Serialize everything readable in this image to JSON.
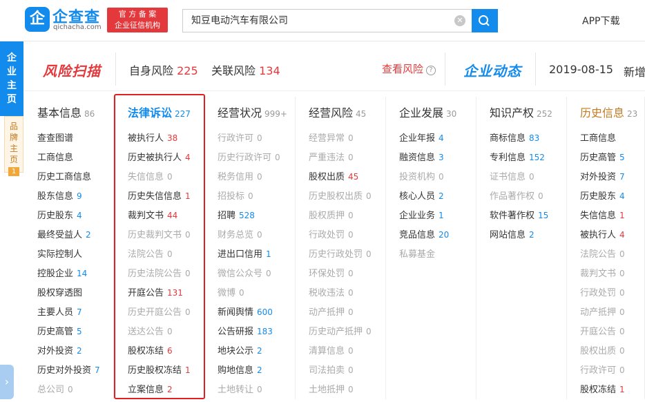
{
  "header": {
    "logo_char": "企",
    "logo_name": "企查查",
    "logo_url": "qichacha.com",
    "cert_line1": "官 方 备 案",
    "cert_line2": "企业征信机构",
    "search_value": "知豆电动汽车有限公司",
    "clear_icon": "clear-icon",
    "search_icon": "search-icon",
    "app_download": "APP下载"
  },
  "side": {
    "company_home": [
      "企",
      "业",
      "主",
      "页"
    ],
    "brand_home": [
      "品",
      "牌",
      "主",
      "页"
    ],
    "brand_count": "1",
    "expand_icon": "chevron-right-icon"
  },
  "risk": {
    "logo": "风险扫描",
    "self_label": "自身风险",
    "self_count": "225",
    "related_label": "关联风险",
    "related_count": "134",
    "check_label": "查看风险",
    "dynamic_logo": "企业动态",
    "dynamic_date": "2019-08-15",
    "dynamic_new": "新增"
  },
  "columns": [
    {
      "title": "基本信息",
      "count": "86",
      "items": [
        {
          "label": "查查图谱",
          "count": ""
        },
        {
          "label": "工商信息",
          "count": ""
        },
        {
          "label": "历史工商信息",
          "count": ""
        },
        {
          "label": "股东信息",
          "count": "9"
        },
        {
          "label": "历史股东",
          "count": "4"
        },
        {
          "label": "最终受益人",
          "count": "2"
        },
        {
          "label": "实际控制人",
          "count": ""
        },
        {
          "label": "控股企业",
          "count": "14"
        },
        {
          "label": "股权穿透图",
          "count": ""
        },
        {
          "label": "主要人员",
          "count": "7"
        },
        {
          "label": "历史高管",
          "count": "5"
        },
        {
          "label": "对外投资",
          "count": "2"
        },
        {
          "label": "历史对外投资",
          "count": "7"
        },
        {
          "label": "总公司",
          "count": "0"
        }
      ]
    },
    {
      "title": "法律诉讼",
      "count": "227",
      "items": [
        {
          "label": "被执行人",
          "count": "38"
        },
        {
          "label": "历史被执行人",
          "count": "4"
        },
        {
          "label": "失信信息",
          "count": "0"
        },
        {
          "label": "历史失信信息",
          "count": "1"
        },
        {
          "label": "裁判文书",
          "count": "44"
        },
        {
          "label": "历史裁判文书",
          "count": "0"
        },
        {
          "label": "法院公告",
          "count": "0"
        },
        {
          "label": "历史法院公告",
          "count": "0"
        },
        {
          "label": "开庭公告",
          "count": "131"
        },
        {
          "label": "历史开庭公告",
          "count": "0"
        },
        {
          "label": "送达公告",
          "count": "0"
        },
        {
          "label": "股权冻结",
          "count": "6"
        },
        {
          "label": "历史股权冻结",
          "count": "1"
        },
        {
          "label": "立案信息",
          "count": "2"
        }
      ]
    },
    {
      "title": "经营状况",
      "count": "999+",
      "items": [
        {
          "label": "行政许可",
          "count": "0"
        },
        {
          "label": "历史行政许可",
          "count": "0"
        },
        {
          "label": "税务信用",
          "count": "0"
        },
        {
          "label": "招投标",
          "count": "0"
        },
        {
          "label": "招聘",
          "count": "528"
        },
        {
          "label": "财务总览",
          "count": "0"
        },
        {
          "label": "进出口信用",
          "count": "1"
        },
        {
          "label": "微信公众号",
          "count": "0"
        },
        {
          "label": "微博",
          "count": "0"
        },
        {
          "label": "新闻舆情",
          "count": "600"
        },
        {
          "label": "公告研报",
          "count": "183"
        },
        {
          "label": "地块公示",
          "count": "2"
        },
        {
          "label": "购地信息",
          "count": "2"
        },
        {
          "label": "土地转让",
          "count": "0"
        }
      ]
    },
    {
      "title": "经营风险",
      "count": "45",
      "items": [
        {
          "label": "经营异常",
          "count": "0"
        },
        {
          "label": "严重违法",
          "count": "0"
        },
        {
          "label": "股权出质",
          "count": "45"
        },
        {
          "label": "历史股权出质",
          "count": "0"
        },
        {
          "label": "股权质押",
          "count": "0"
        },
        {
          "label": "行政处罚",
          "count": "0"
        },
        {
          "label": "历史行政处罚",
          "count": "0"
        },
        {
          "label": "环保处罚",
          "count": "0"
        },
        {
          "label": "税收违法",
          "count": "0"
        },
        {
          "label": "动产抵押",
          "count": "0"
        },
        {
          "label": "历史动产抵押",
          "count": "0"
        },
        {
          "label": "清算信息",
          "count": "0"
        },
        {
          "label": "司法拍卖",
          "count": "0"
        },
        {
          "label": "土地抵押",
          "count": "0"
        }
      ]
    },
    {
      "title": "企业发展",
      "count": "30",
      "items": [
        {
          "label": "企业年报",
          "count": "4"
        },
        {
          "label": "融资信息",
          "count": "3"
        },
        {
          "label": "投资机构",
          "count": "0"
        },
        {
          "label": "核心人员",
          "count": "2"
        },
        {
          "label": "企业业务",
          "count": "1"
        },
        {
          "label": "竞品信息",
          "count": "20"
        },
        {
          "label": "私募基金",
          "count": ""
        }
      ]
    },
    {
      "title": "知识产权",
      "count": "252",
      "items": [
        {
          "label": "商标信息",
          "count": "83"
        },
        {
          "label": "专利信息",
          "count": "152"
        },
        {
          "label": "证书信息",
          "count": "0"
        },
        {
          "label": "作品著作权",
          "count": "0"
        },
        {
          "label": "软件著作权",
          "count": "15"
        },
        {
          "label": "网站信息",
          "count": "2"
        }
      ]
    },
    {
      "title": "历史信息",
      "count": "23",
      "items": [
        {
          "label": "工商信息",
          "count": ""
        },
        {
          "label": "历史高管",
          "count": "5"
        },
        {
          "label": "对外投资",
          "count": "7"
        },
        {
          "label": "历史股东",
          "count": "4"
        },
        {
          "label": "失信信息",
          "count": "1"
        },
        {
          "label": "被执行人",
          "count": "4"
        },
        {
          "label": "法院公告",
          "count": "0"
        },
        {
          "label": "裁判文书",
          "count": "0"
        },
        {
          "label": "行政处罚",
          "count": "0"
        },
        {
          "label": "动产抵押",
          "count": "0"
        },
        {
          "label": "开庭公告",
          "count": "0"
        },
        {
          "label": "股权出质",
          "count": "0"
        },
        {
          "label": "行政许可",
          "count": "0"
        },
        {
          "label": "股权冻结",
          "count": "1"
        }
      ]
    }
  ],
  "colors": {
    "brand_blue": "#128bed",
    "risk_red": "#e4393c",
    "history_orange": "#c47a1f",
    "highlight_border": "#e02020"
  }
}
